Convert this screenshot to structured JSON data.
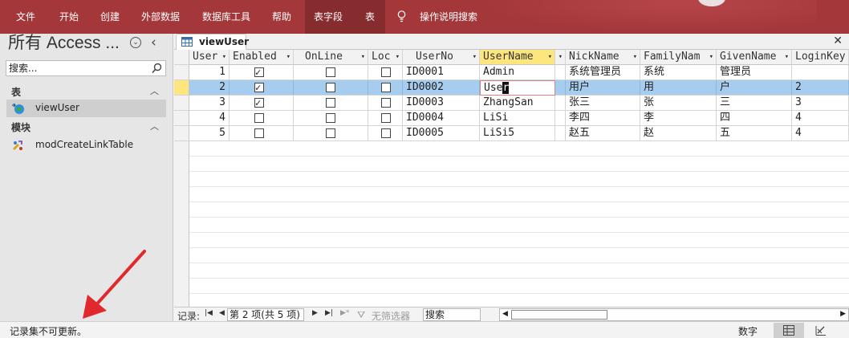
{
  "ribbon": {
    "tabs": [
      "文件",
      "开始",
      "创建",
      "外部数据",
      "数据库工具",
      "帮助",
      "表字段",
      "表"
    ],
    "tell_me": "操作说明搜索"
  },
  "nav": {
    "title": "所有 Access ...",
    "search_placeholder": "搜索...",
    "groups": [
      {
        "label": "表",
        "items": [
          {
            "label": "viewUser",
            "icon": "linked-table-icon"
          }
        ]
      },
      {
        "label": "模块",
        "items": [
          {
            "label": "modCreateLinkTable",
            "icon": "module-icon"
          }
        ]
      }
    ]
  },
  "document": {
    "tab_label": "viewUser",
    "columns": [
      "User",
      "Enabled",
      "OnLine",
      "Loc",
      "UserNo",
      "UserName",
      "NickName",
      "FamilyNam",
      "GivenName",
      "LoginKey"
    ],
    "rows": [
      {
        "id": "1",
        "enabled": true,
        "online": false,
        "loc": false,
        "userno": "ID0001",
        "username": "Admin",
        "nickname": "系统管理员",
        "family": "系统",
        "given": "管理员",
        "loginkey": ""
      },
      {
        "id": "2",
        "enabled": true,
        "online": false,
        "loc": false,
        "userno": "ID0002",
        "username": "User",
        "nickname": "用户",
        "family": "用",
        "given": "户",
        "loginkey": "2"
      },
      {
        "id": "3",
        "enabled": true,
        "online": false,
        "loc": false,
        "userno": "ID0003",
        "username": "ZhangSan",
        "nickname": "张三",
        "family": "张",
        "given": "三",
        "loginkey": "3"
      },
      {
        "id": "4",
        "enabled": false,
        "online": false,
        "loc": false,
        "userno": "ID0004",
        "username": "LiSi",
        "nickname": "李四",
        "family": "李",
        "given": "四",
        "loginkey": "4"
      },
      {
        "id": "5",
        "enabled": false,
        "online": false,
        "loc": false,
        "userno": "ID0005",
        "username": "LiSi5",
        "nickname": "赵五",
        "family": "赵",
        "given": "五",
        "loginkey": "4"
      }
    ],
    "current_row": 2,
    "editing_prefix": "Use",
    "editing_cursor_char": "r"
  },
  "record_nav": {
    "label": "记录:",
    "position": "第 2 项(共 5 项)",
    "filter": "无筛选器",
    "search": "搜索"
  },
  "status": {
    "message": "记录集不可更新。",
    "mode": "数字"
  },
  "colors": {
    "ribbon": "#a4373a",
    "selected_header": "#fde67e",
    "row_highlight": "#a6cdee",
    "arrow": "#e0282e"
  }
}
